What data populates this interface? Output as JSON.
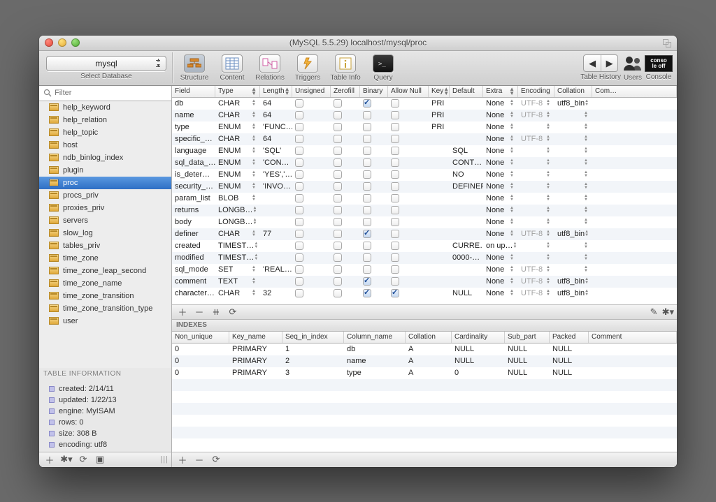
{
  "window_title": "(MySQL 5.5.29) localhost/mysql/proc",
  "db_dropdown": {
    "value": "mysql",
    "caption": "Select Database"
  },
  "toolbar": {
    "structure": "Structure",
    "content": "Content",
    "relations": "Relations",
    "triggers": "Triggers",
    "tableinfo": "Table Info",
    "query": "Query",
    "th": "Table History",
    "users": "Users",
    "console": "Console"
  },
  "console_badge": {
    "l1": "conso",
    "l2": "le off"
  },
  "filter_placeholder": "Filter",
  "tables": [
    "help_keyword",
    "help_relation",
    "help_topic",
    "host",
    "ndb_binlog_index",
    "plugin",
    "proc",
    "procs_priv",
    "proxies_priv",
    "servers",
    "slow_log",
    "tables_priv",
    "time_zone",
    "time_zone_leap_second",
    "time_zone_name",
    "time_zone_transition",
    "time_zone_transition_type",
    "user"
  ],
  "selected_table": "proc",
  "info_header": "TABLE INFORMATION",
  "info": [
    "created: 2/14/11",
    "updated: 1/22/13",
    "engine: MyISAM",
    "rows: 0",
    "size: 308 B",
    "encoding: utf8"
  ],
  "field_headers": [
    "Field",
    "Type",
    "Length",
    "Unsigned",
    "Zerofill",
    "Binary",
    "Allow Null",
    "Key",
    "Default",
    "Extra",
    "Encoding",
    "Collation",
    "Com…"
  ],
  "fields": [
    {
      "f": "db",
      "t": "CHAR",
      "l": "64",
      "b": true,
      "k": "PRI",
      "e": "None",
      "enc": "UTF-8",
      "col": "utf8_bin"
    },
    {
      "f": "name",
      "t": "CHAR",
      "l": "64",
      "k": "PRI",
      "e": "None",
      "enc": "UTF-8"
    },
    {
      "f": "type",
      "t": "ENUM",
      "l": "'FUNC…",
      "k": "PRI",
      "e": "None"
    },
    {
      "f": "specific_…",
      "t": "CHAR",
      "l": "64",
      "e": "None",
      "enc": "UTF-8"
    },
    {
      "f": "language",
      "t": "ENUM",
      "l": "'SQL'",
      "d": "SQL",
      "e": "None"
    },
    {
      "f": "sql_data_…",
      "t": "ENUM",
      "l": "'CON…",
      "d": "CONT…",
      "e": "None"
    },
    {
      "f": "is_deter…",
      "t": "ENUM",
      "l": "'YES','…",
      "d": "NO",
      "e": "None"
    },
    {
      "f": "security_…",
      "t": "ENUM",
      "l": "'INVO…",
      "d": "DEFINER",
      "e": "None"
    },
    {
      "f": "param_list",
      "t": "BLOB",
      "e": "None"
    },
    {
      "f": "returns",
      "t": "LONGB…",
      "e": "None"
    },
    {
      "f": "body",
      "t": "LONGB…",
      "e": "None"
    },
    {
      "f": "definer",
      "t": "CHAR",
      "l": "77",
      "b": true,
      "e": "None",
      "enc": "UTF-8",
      "col": "utf8_bin"
    },
    {
      "f": "created",
      "t": "TIMEST…",
      "d": "CURRE…",
      "e": "on up…"
    },
    {
      "f": "modified",
      "t": "TIMEST…",
      "d": "0000-…",
      "e": "None"
    },
    {
      "f": "sql_mode",
      "t": "SET",
      "l": "'REAL…",
      "e": "None",
      "enc": "UTF-8"
    },
    {
      "f": "comment",
      "t": "TEXT",
      "b": true,
      "e": "None",
      "enc": "UTF-8",
      "col": "utf8_bin"
    },
    {
      "f": "character…",
      "t": "CHAR",
      "l": "32",
      "b": true,
      "an": true,
      "d": "NULL",
      "e": "None",
      "enc": "UTF-8",
      "col": "utf8_bin"
    }
  ],
  "indexes_label": "INDEXES",
  "index_headers": [
    "Non_unique",
    "Key_name",
    "Seq_in_index",
    "Column_name",
    "Collation",
    "Cardinality",
    "Sub_part",
    "Packed",
    "Comment"
  ],
  "indexes": [
    {
      "nu": "0",
      "kn": "PRIMARY",
      "si": "1",
      "cn": "db",
      "col": "A",
      "card": "NULL",
      "sp": "NULL",
      "pk": "NULL"
    },
    {
      "nu": "0",
      "kn": "PRIMARY",
      "si": "2",
      "cn": "name",
      "col": "A",
      "card": "NULL",
      "sp": "NULL",
      "pk": "NULL"
    },
    {
      "nu": "0",
      "kn": "PRIMARY",
      "si": "3",
      "cn": "type",
      "col": "A",
      "card": "0",
      "sp": "NULL",
      "pk": "NULL"
    }
  ]
}
